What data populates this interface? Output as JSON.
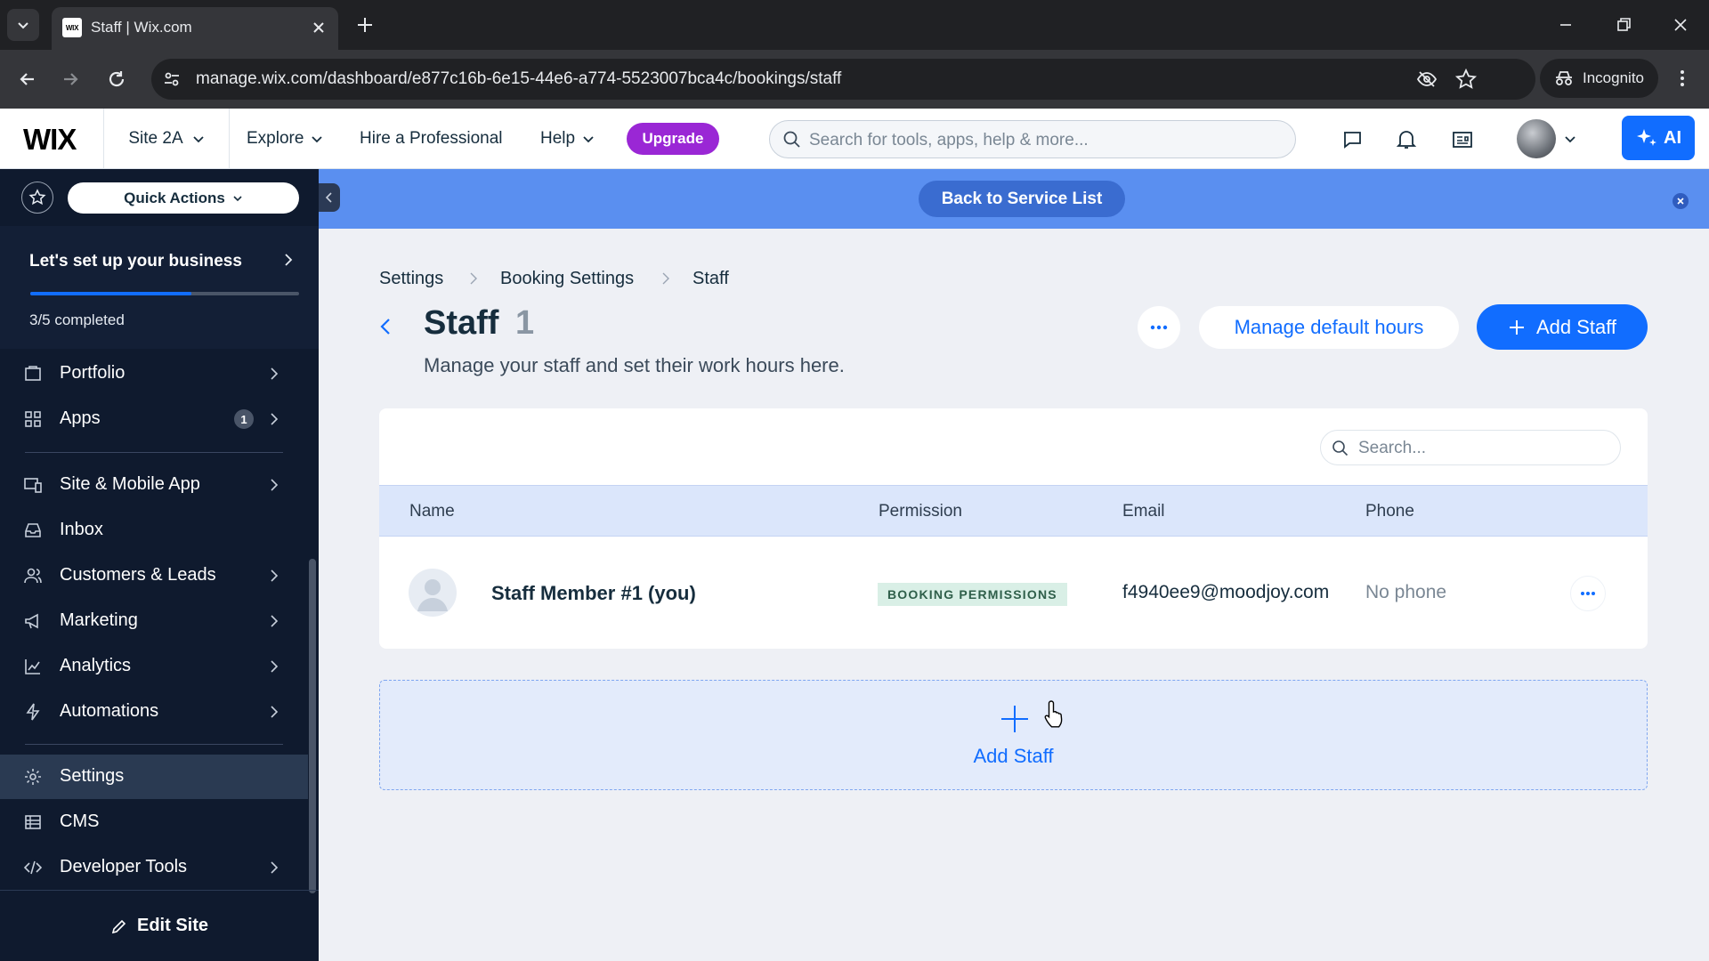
{
  "browser": {
    "tab_title": "Staff | Wix.com",
    "favicon_text": "WIX",
    "url": "manage.wix.com/dashboard/e877c16b-6e15-44e6-a774-5523007bca4c/bookings/staff",
    "incognito_label": "Incognito"
  },
  "topbar": {
    "logo": "WIX",
    "site_name": "Site 2A",
    "nav": [
      "Explore",
      "Hire a Professional",
      "Help"
    ],
    "upgrade_label": "Upgrade",
    "search_placeholder": "Search for tools, apps, help & more...",
    "ai_label": "AI"
  },
  "sidebar": {
    "quick_actions_label": "Quick Actions",
    "setup": {
      "title": "Let's set up your business",
      "progress_text": "3/5 completed",
      "progress": 0.6
    },
    "items": [
      {
        "label": "Portfolio",
        "icon": "portfolio-icon",
        "chevron": true
      },
      {
        "label": "Apps",
        "icon": "apps-icon",
        "chevron": true,
        "badge": "1"
      },
      {
        "label": "Site & Mobile App",
        "icon": "site-mobile-icon",
        "chevron": true
      },
      {
        "label": "Inbox",
        "icon": "inbox-icon",
        "chevron": false
      },
      {
        "label": "Customers & Leads",
        "icon": "customers-icon",
        "chevron": true
      },
      {
        "label": "Marketing",
        "icon": "marketing-icon",
        "chevron": true
      },
      {
        "label": "Analytics",
        "icon": "analytics-icon",
        "chevron": true
      },
      {
        "label": "Automations",
        "icon": "automations-icon",
        "chevron": true
      },
      {
        "label": "Settings",
        "icon": "settings-icon",
        "chevron": false,
        "active": true
      },
      {
        "label": "CMS",
        "icon": "cms-icon",
        "chevron": false
      },
      {
        "label": "Developer Tools",
        "icon": "developer-tools-icon",
        "chevron": true
      }
    ],
    "edit_site_label": "Edit Site"
  },
  "banner": {
    "back_label": "Back to Service List"
  },
  "breadcrumb": [
    "Settings",
    "Booking Settings",
    "Staff"
  ],
  "page": {
    "title": "Staff",
    "count": "1",
    "subtitle": "Manage your staff and set their work hours here.",
    "manage_hours_label": "Manage default hours",
    "add_staff_label": "Add Staff"
  },
  "table": {
    "search_placeholder": "Search...",
    "columns": [
      "Name",
      "Permission",
      "Email",
      "Phone"
    ],
    "rows": [
      {
        "name": "Staff Member #1 (you)",
        "permission": "BOOKING PERMISSIONS",
        "email": "f4940ee9@moodjoy.com",
        "phone": "No phone"
      }
    ]
  },
  "add_card": {
    "label": "Add Staff"
  },
  "colors": {
    "accent": "#116dff",
    "upgrade": "#9a27d5",
    "sidebar_bg": "#0f1a2e",
    "banner": "#5a8ff0"
  }
}
